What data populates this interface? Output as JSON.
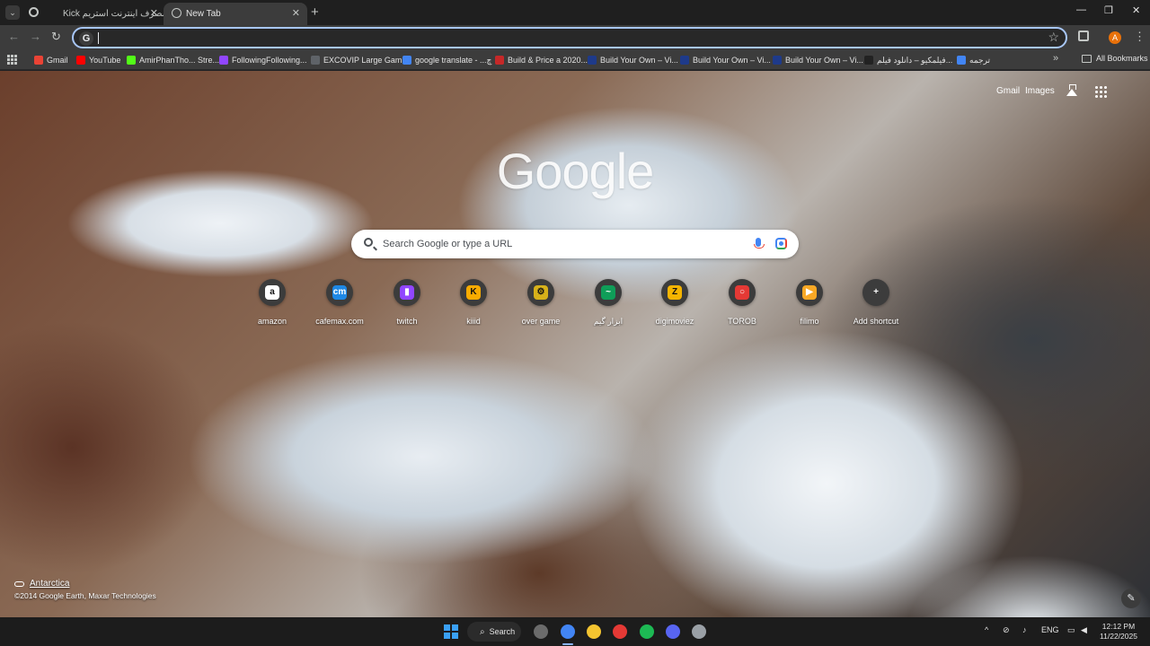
{
  "tabs": [
    {
      "label": "Kick مصرف اینترنت استریم",
      "close": "✕",
      "active": false
    },
    {
      "label": "New Tab",
      "close": "✕",
      "active": true
    }
  ],
  "tabstrip": {
    "new_tab_glyph": "+",
    "minimize": "—",
    "maximize": "❐",
    "close": "✕",
    "search_glyph": "⌄"
  },
  "toolbar": {
    "back": "←",
    "forward": "→",
    "reload": "↻",
    "omnibox_icon": "G",
    "omnibox_value": "",
    "star": "☆",
    "profile_letter": "A",
    "menu": "⋮"
  },
  "bookmarks": {
    "items": [
      {
        "label": "Gmail",
        "color": "#ea4335"
      },
      {
        "label": "YouTube",
        "color": "#ff0000"
      },
      {
        "label": "AmirPhanTho... Stre...",
        "color": "#53fc18"
      },
      {
        "label": "FollowingFollowing...",
        "color": "#9146ff"
      },
      {
        "label": "EXCOVIP Large Gam...",
        "color": "#5f6368"
      },
      {
        "label": "google translate - ...چ",
        "color": "#4285f4"
      },
      {
        "label": "Build & Price a 2020...",
        "color": "#c62828"
      },
      {
        "label": "Build Your Own – Vi...",
        "color": "#1e3a8a"
      },
      {
        "label": "Build Your Own – Vi...",
        "color": "#1e3a8a"
      },
      {
        "label": "Build Your Own – Vi...",
        "color": "#1e3a8a"
      },
      {
        "label": "فیلمکیو – دانلود فیلم...",
        "color": "#222222"
      },
      {
        "label": "ترجمه",
        "color": "#4285f4"
      }
    ],
    "more": "»",
    "all_bookmarks": "All Bookmarks"
  },
  "ntp": {
    "gmail": "Gmail",
    "images": "Images",
    "logo": "Google",
    "search_placeholder": "Search Google or type a URL",
    "shortcuts": [
      {
        "label": "amazon",
        "glyph": "a",
        "color": "#ffffff",
        "text_color": "#111111"
      },
      {
        "label": "cafemax.com",
        "glyph": "cm",
        "color": "#1e88e5",
        "text_color": "#ffffff"
      },
      {
        "label": "twitch",
        "glyph": "▮",
        "color": "#9146ff",
        "text_color": "#ffffff"
      },
      {
        "label": "kiiid",
        "glyph": "K",
        "color": "#f9ab00",
        "text_color": "#111111"
      },
      {
        "label": "over game",
        "glyph": "⚙",
        "color": "#d7b11a",
        "text_color": "#111111"
      },
      {
        "label": "ابزار گیم",
        "glyph": "~",
        "color": "#0f9d58",
        "text_color": "#ffffff"
      },
      {
        "label": "digimoviez",
        "glyph": "Z",
        "color": "#f5b400",
        "text_color": "#111111"
      },
      {
        "label": "TOROB",
        "glyph": "○",
        "color": "#e53935",
        "text_color": "#ffffff"
      },
      {
        "label": "filimo",
        "glyph": "▶",
        "color": "#f9a825",
        "text_color": "#ffffff"
      },
      {
        "label": "Add shortcut",
        "glyph": "+",
        "color": "#3c3c3c",
        "text_color": "#ffffff"
      }
    ],
    "attribution_place": "Antarctica",
    "attribution_credit": "©2014 Google Earth, Maxar Technologies",
    "customize_glyph": "✎"
  },
  "taskbar": {
    "search_label": "Search",
    "apps": [
      {
        "name": "task-view",
        "color": "#6b6b6b"
      },
      {
        "name": "chrome",
        "color": "#4285f4"
      },
      {
        "name": "file-explorer",
        "color": "#f4c430"
      },
      {
        "name": "media-player",
        "color": "#e53935"
      },
      {
        "name": "spotify",
        "color": "#1db954"
      },
      {
        "name": "discord",
        "color": "#5865f2"
      },
      {
        "name": "steam",
        "color": "#9aa0a6"
      }
    ],
    "tray_chevron": "^",
    "language": "ENG",
    "time": "12:12 PM",
    "date": "11/22/2025"
  }
}
